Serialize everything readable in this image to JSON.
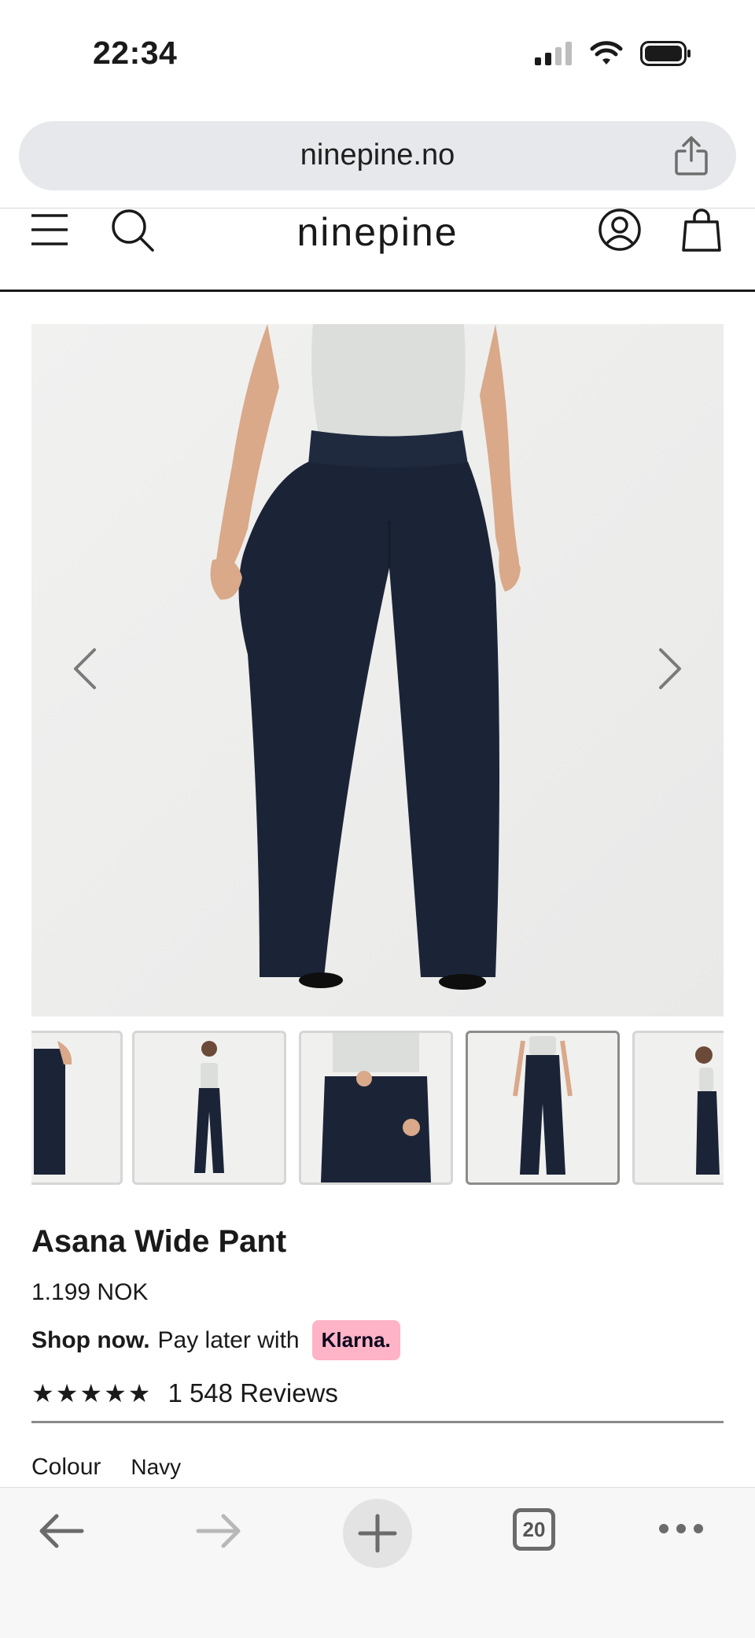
{
  "status_bar": {
    "time": "22:34"
  },
  "browser": {
    "url": "ninepine.no",
    "tab_count": "20"
  },
  "site": {
    "logo": "ninepine"
  },
  "product": {
    "title": "Asana Wide Pant",
    "price": "1.199 NOK",
    "klarna_bold": "Shop now.",
    "klarna_text": "Pay later with",
    "klarna_badge": "Klarna.",
    "stars": "★★★★★",
    "reviews": "1 548 Reviews",
    "colour_label": "Colour",
    "colour_value": "Navy",
    "thumbnail_count": 5,
    "active_thumbnail": 4
  },
  "colors": {
    "pant": "#1b2437",
    "top": "#dcdedb",
    "skin": "#d9a98a",
    "klarna": "#ffb3c7"
  }
}
